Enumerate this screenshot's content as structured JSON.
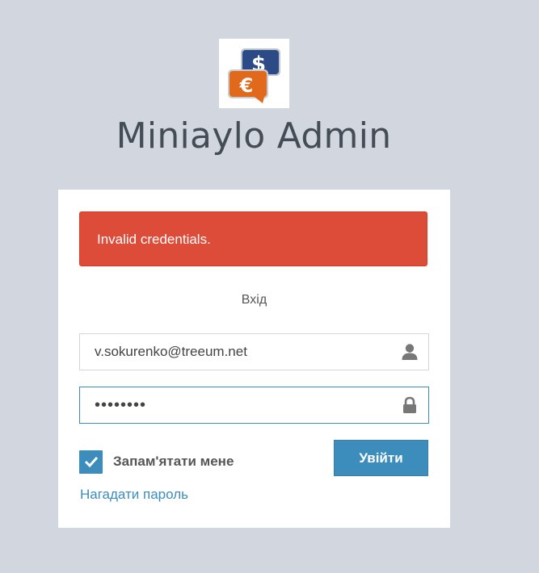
{
  "app": {
    "title": "Miniaylo Admin"
  },
  "alert": {
    "message": "Invalid credentials."
  },
  "login": {
    "box_message": "Вхід",
    "email_value": "v.sokurenko@treeum.net",
    "password_value": "12345678",
    "remember_label": "Запам'ятати мене",
    "remember_checked": true,
    "submit_label": "Увійти",
    "forgot_label": "Нагадати пароль"
  },
  "icons": {
    "logo": "currency-exchange-logo",
    "email": "user-icon",
    "password": "lock-icon",
    "checkbox": "checkmark-icon"
  },
  "colors": {
    "background": "#d2d6de",
    "alert": "#dd4b39",
    "accent": "#3c8dbc"
  }
}
